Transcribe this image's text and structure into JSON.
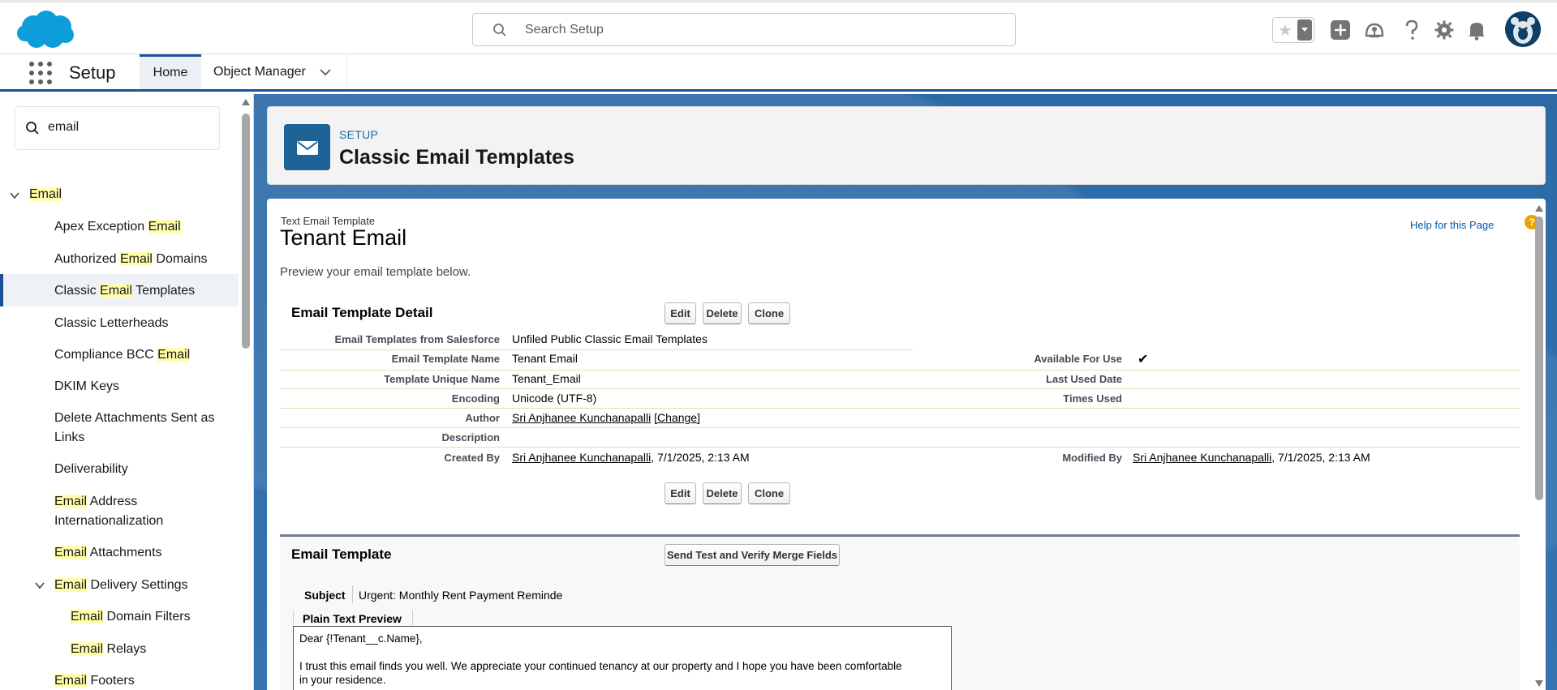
{
  "header": {
    "search_placeholder": "Search Setup"
  },
  "nav": {
    "app_name": "Setup",
    "tabs": [
      {
        "label": "Home"
      },
      {
        "label": "Object Manager"
      }
    ]
  },
  "sidebar": {
    "quickfind_value": "email",
    "items": [
      {
        "pre": "",
        "hl": "Email",
        "post": ""
      },
      {
        "pre": "Apex Exception ",
        "hl": "Email",
        "post": ""
      },
      {
        "pre": "Authorized ",
        "hl": "Email",
        "post": " Domains"
      },
      {
        "pre": "Classic ",
        "hl": "Email",
        "post": " Templates"
      },
      {
        "pre": "Classic Letterheads",
        "hl": "",
        "post": ""
      },
      {
        "pre": "Compliance BCC ",
        "hl": "Email",
        "post": ""
      },
      {
        "pre": "DKIM Keys",
        "hl": "",
        "post": ""
      },
      {
        "pre": "Delete Attachments Sent as",
        "hl": "",
        "post": ""
      },
      {
        "pre": "Links",
        "hl": "",
        "post": ""
      },
      {
        "pre": "Deliverability",
        "hl": "",
        "post": ""
      },
      {
        "pre": "",
        "hl": "Email",
        "post": " Address"
      },
      {
        "pre": "Internationalization",
        "hl": "",
        "post": ""
      },
      {
        "pre": "",
        "hl": "Email",
        "post": " Attachments"
      },
      {
        "pre": "",
        "hl": "Email",
        "post": " Delivery Settings"
      },
      {
        "pre": "",
        "hl": "Email",
        "post": " Domain Filters"
      },
      {
        "pre": "",
        "hl": "Email",
        "post": " Relays"
      },
      {
        "pre": "",
        "hl": "Email",
        "post": " Footers"
      }
    ]
  },
  "page_header": {
    "eyebrow": "SETUP",
    "title": "Classic Email Templates"
  },
  "content": {
    "template_type": "Text Email Template",
    "template_name": "Tenant Email",
    "help_link": "Help for this Page",
    "help_icon": "?",
    "preview_text": "Preview your email template below.",
    "detail_title": "Email Template Detail",
    "buttons": {
      "edit": "Edit",
      "delete": "Delete",
      "clone": "Clone",
      "send_test": "Send Test and Verify Merge Fields"
    },
    "fields": {
      "folder_label": "Email Templates from Salesforce",
      "folder_value": "Unfiled Public Classic Email Templates",
      "name_label": "Email Template Name",
      "name_value": "Tenant Email",
      "available_label": "Available For Use",
      "available_value": "✔",
      "unique_label": "Template Unique Name",
      "unique_value": "Tenant_Email",
      "last_used_label": "Last Used Date",
      "encoding_label": "Encoding",
      "encoding_value": "Unicode (UTF-8)",
      "times_used_label": "Times Used",
      "author_label": "Author",
      "author_value": "Sri Anjhanee Kunchanapalli",
      "author_change": "[Change]",
      "description_label": "Description",
      "created_label": "Created By",
      "created_user": "Sri Anjhanee Kunchanapalli",
      "created_date": ", 7/1/2025, 2:13 AM",
      "modified_label": "Modified By",
      "modified_user": "Sri Anjhanee Kunchanapalli",
      "modified_date": ", 7/1/2025, 2:13 AM"
    },
    "email_template": {
      "title": "Email Template",
      "subject_label": "Subject",
      "subject_value": "Urgent: Monthly Rent Payment Reminde",
      "plain_text_label": "Plain Text Preview",
      "body_line1": "Dear {!Tenant__c.Name},",
      "body_line2": "I trust this email finds you well. We appreciate your continued tenancy at our property and I hope you have been comfortable",
      "body_line3": "in your residence."
    }
  }
}
